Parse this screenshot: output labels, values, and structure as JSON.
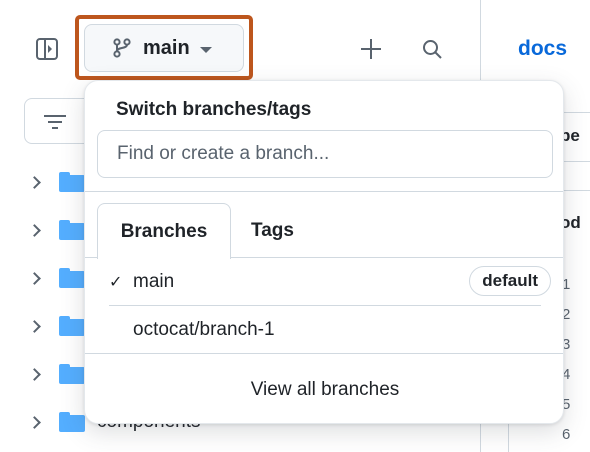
{
  "header": {
    "branch_button_label": "main",
    "docs_title": "docs"
  },
  "file_tree": {
    "items": [
      {
        "label": ""
      },
      {
        "label": ""
      },
      {
        "label": ""
      },
      {
        "label": ""
      },
      {
        "label": ""
      },
      {
        "label": "components"
      }
    ]
  },
  "right_panel": {
    "stub_texts": [
      "pe",
      "od"
    ],
    "line_numbers": [
      "1",
      "2",
      "3",
      "4",
      "5",
      "6"
    ]
  },
  "branch_dropdown": {
    "title": "Switch branches/tags",
    "search_placeholder": "Find or create a branch...",
    "tabs": [
      {
        "label": "Branches",
        "active": true
      },
      {
        "label": "Tags",
        "active": false
      }
    ],
    "branches": [
      {
        "name": "main",
        "selected": true,
        "badge": "default"
      },
      {
        "name": "octocat/branch-1",
        "selected": false,
        "badge": ""
      }
    ],
    "check_glyph": "✓",
    "view_all_label": "View all branches"
  },
  "colors": {
    "highlight": "#bd561d",
    "link": "#0969da",
    "folder": "#54aeff"
  },
  "icons": [
    "sidebar-toggle-icon",
    "git-branch-icon",
    "caret-down-icon",
    "plus-icon",
    "search-icon",
    "filter-icon",
    "chevron-right-icon",
    "folder-icon",
    "check-icon"
  ]
}
